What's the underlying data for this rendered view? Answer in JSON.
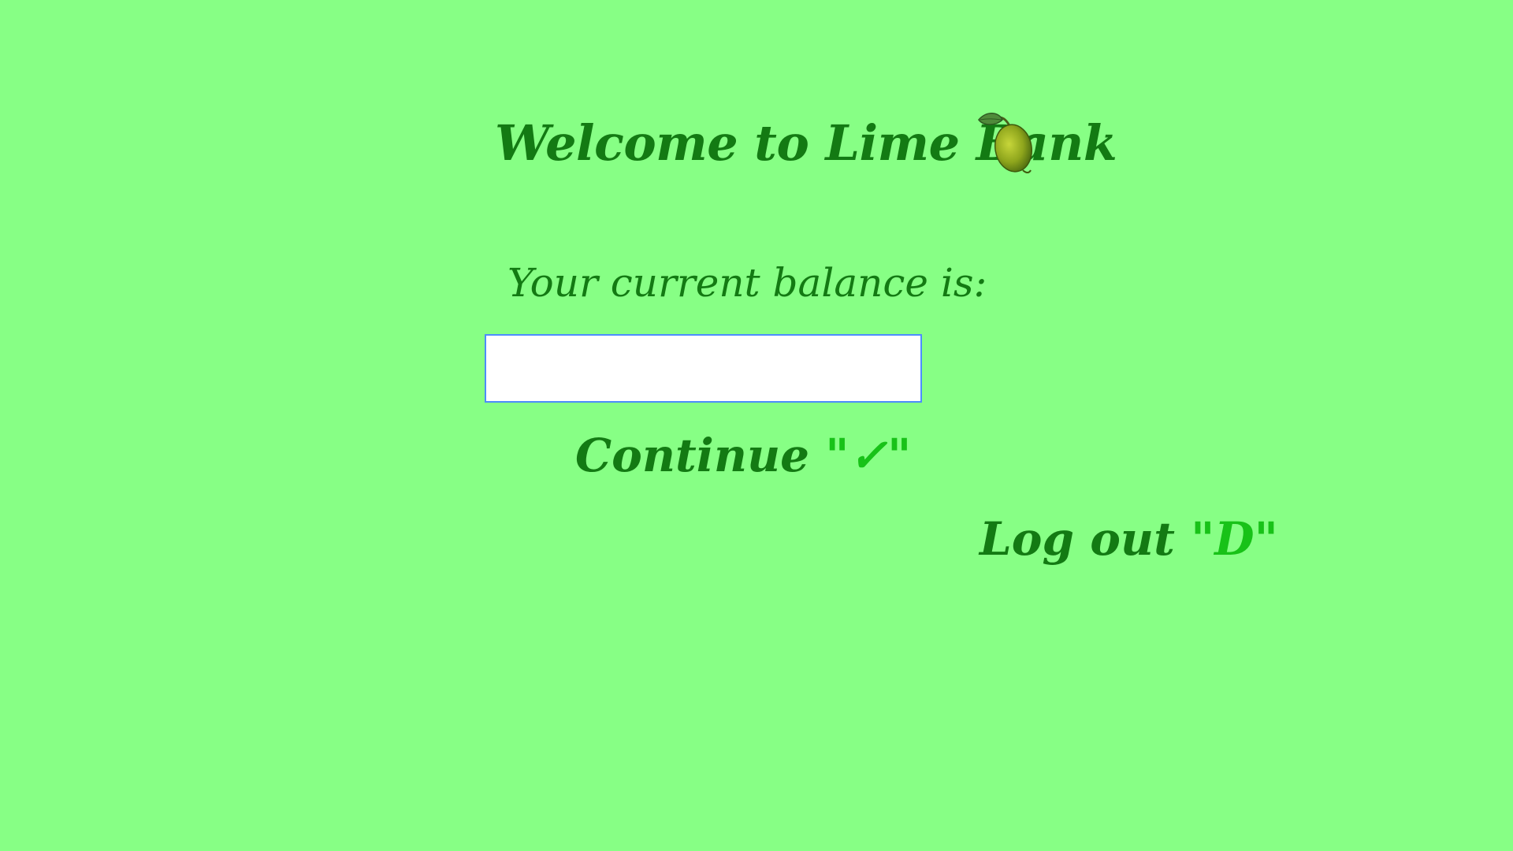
{
  "header": {
    "title": "Welcome to Lime Bank",
    "logo_icon": "lime-fruit-icon"
  },
  "balance": {
    "label": "Your current balance is:",
    "value": ""
  },
  "actions": {
    "continue_label": "Continue",
    "continue_key": "\"✓\"",
    "logout_label": "Log out",
    "logout_key": "\"D\""
  },
  "colors": {
    "background": "#87ff85",
    "text": "#137a13",
    "key_hint": "#18c218",
    "input_border": "#4d8cff"
  }
}
